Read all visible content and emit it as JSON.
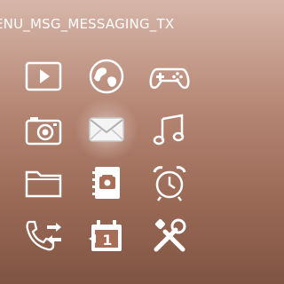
{
  "header": {
    "title": "ENU_MSG_MESSAGING_TX"
  },
  "menu": {
    "selected_index": 4,
    "items": [
      {
        "icon": "play-icon"
      },
      {
        "icon": "globe-icon"
      },
      {
        "icon": "gamepad-icon"
      },
      {
        "icon": "camera-icon"
      },
      {
        "icon": "envelope-icon"
      },
      {
        "icon": "music-note-icon"
      },
      {
        "icon": "folder-icon"
      },
      {
        "icon": "phonebook-icon"
      },
      {
        "icon": "alarm-clock-icon"
      },
      {
        "icon": "call-transfer-icon"
      },
      {
        "icon": "calendar-icon"
      },
      {
        "icon": "tools-icon"
      }
    ]
  },
  "colors": {
    "icon_fill": "#ffffff",
    "icon_shape": "#a86d57",
    "selected_bg": "#f2f2f2"
  }
}
